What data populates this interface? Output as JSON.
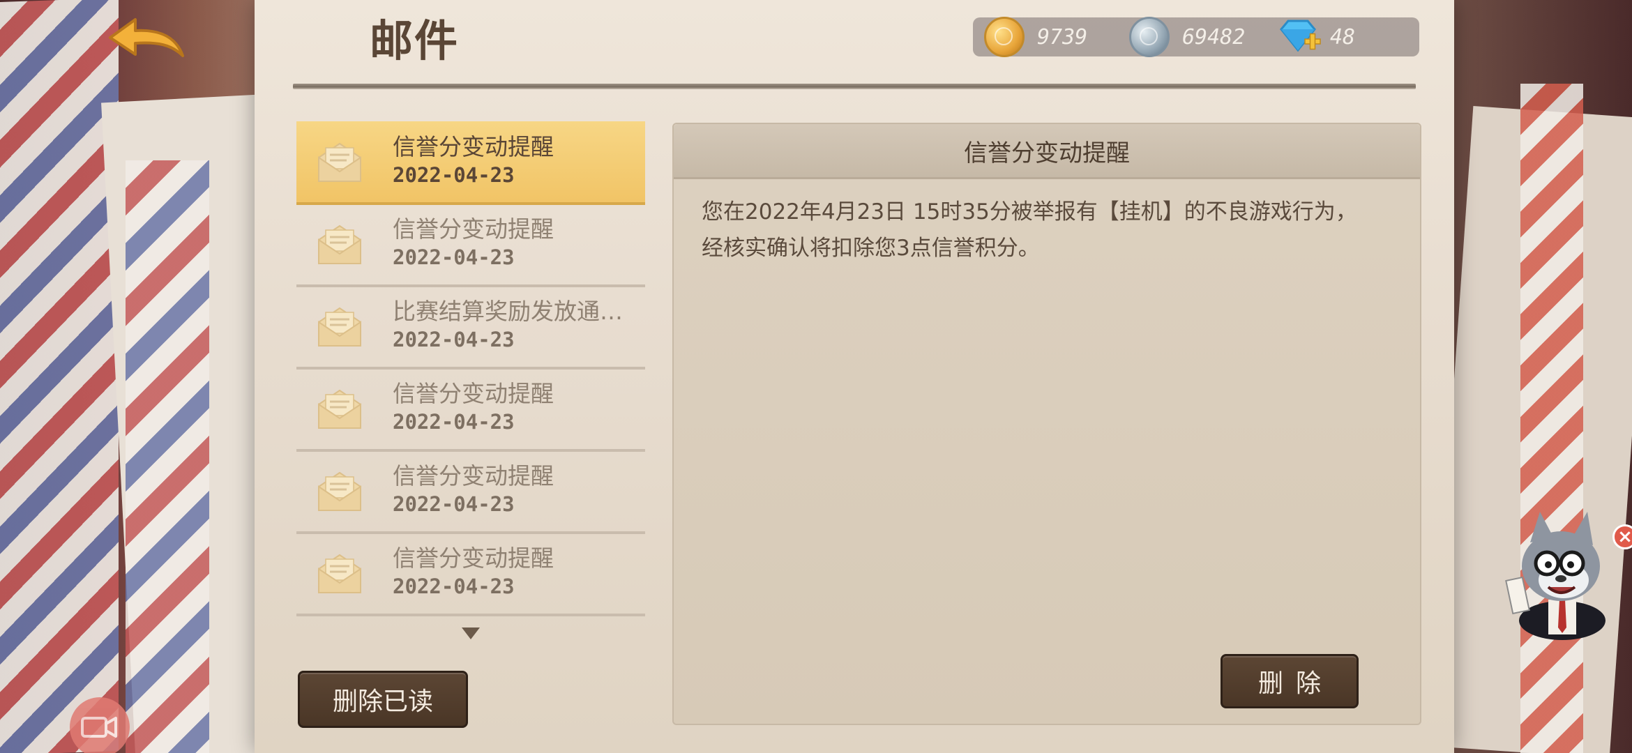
{
  "header": {
    "title": "邮件",
    "back_icon": "back-arrow-icon"
  },
  "currencies": [
    {
      "icon": "gold-coin-icon",
      "value": "9739",
      "color": "#e8a53a"
    },
    {
      "icon": "silver-coin-icon",
      "value": "69482",
      "color": "#95a7b4"
    },
    {
      "icon": "diamond-plus-icon",
      "value": "48",
      "color": "#4fb8f0"
    }
  ],
  "mail_list": {
    "items": [
      {
        "title": "信誉分变动提醒",
        "date": "2022-04-23",
        "selected": true
      },
      {
        "title": "信誉分变动提醒",
        "date": "2022-04-23",
        "selected": false
      },
      {
        "title": "比赛结算奖励发放通…",
        "date": "2022-04-23",
        "selected": false
      },
      {
        "title": "信誉分变动提醒",
        "date": "2022-04-23",
        "selected": false
      },
      {
        "title": "信誉分变动提醒",
        "date": "2022-04-23",
        "selected": false
      },
      {
        "title": "信誉分变动提醒",
        "date": "2022-04-23",
        "selected": false
      }
    ],
    "delete_read_label": "删除已读"
  },
  "detail": {
    "title": "信誉分变动提醒",
    "body_line1": "您在2022年4月23日 15时35分被举报有【挂机】的不良游戏行为，",
    "body_line2": "经核实确认将扣除您3点信誉积分。",
    "delete_label": "删除"
  },
  "colors": {
    "selected_bg": "#f1c466",
    "button_dark": "#4a3626",
    "paper": "#e8ddd0"
  }
}
